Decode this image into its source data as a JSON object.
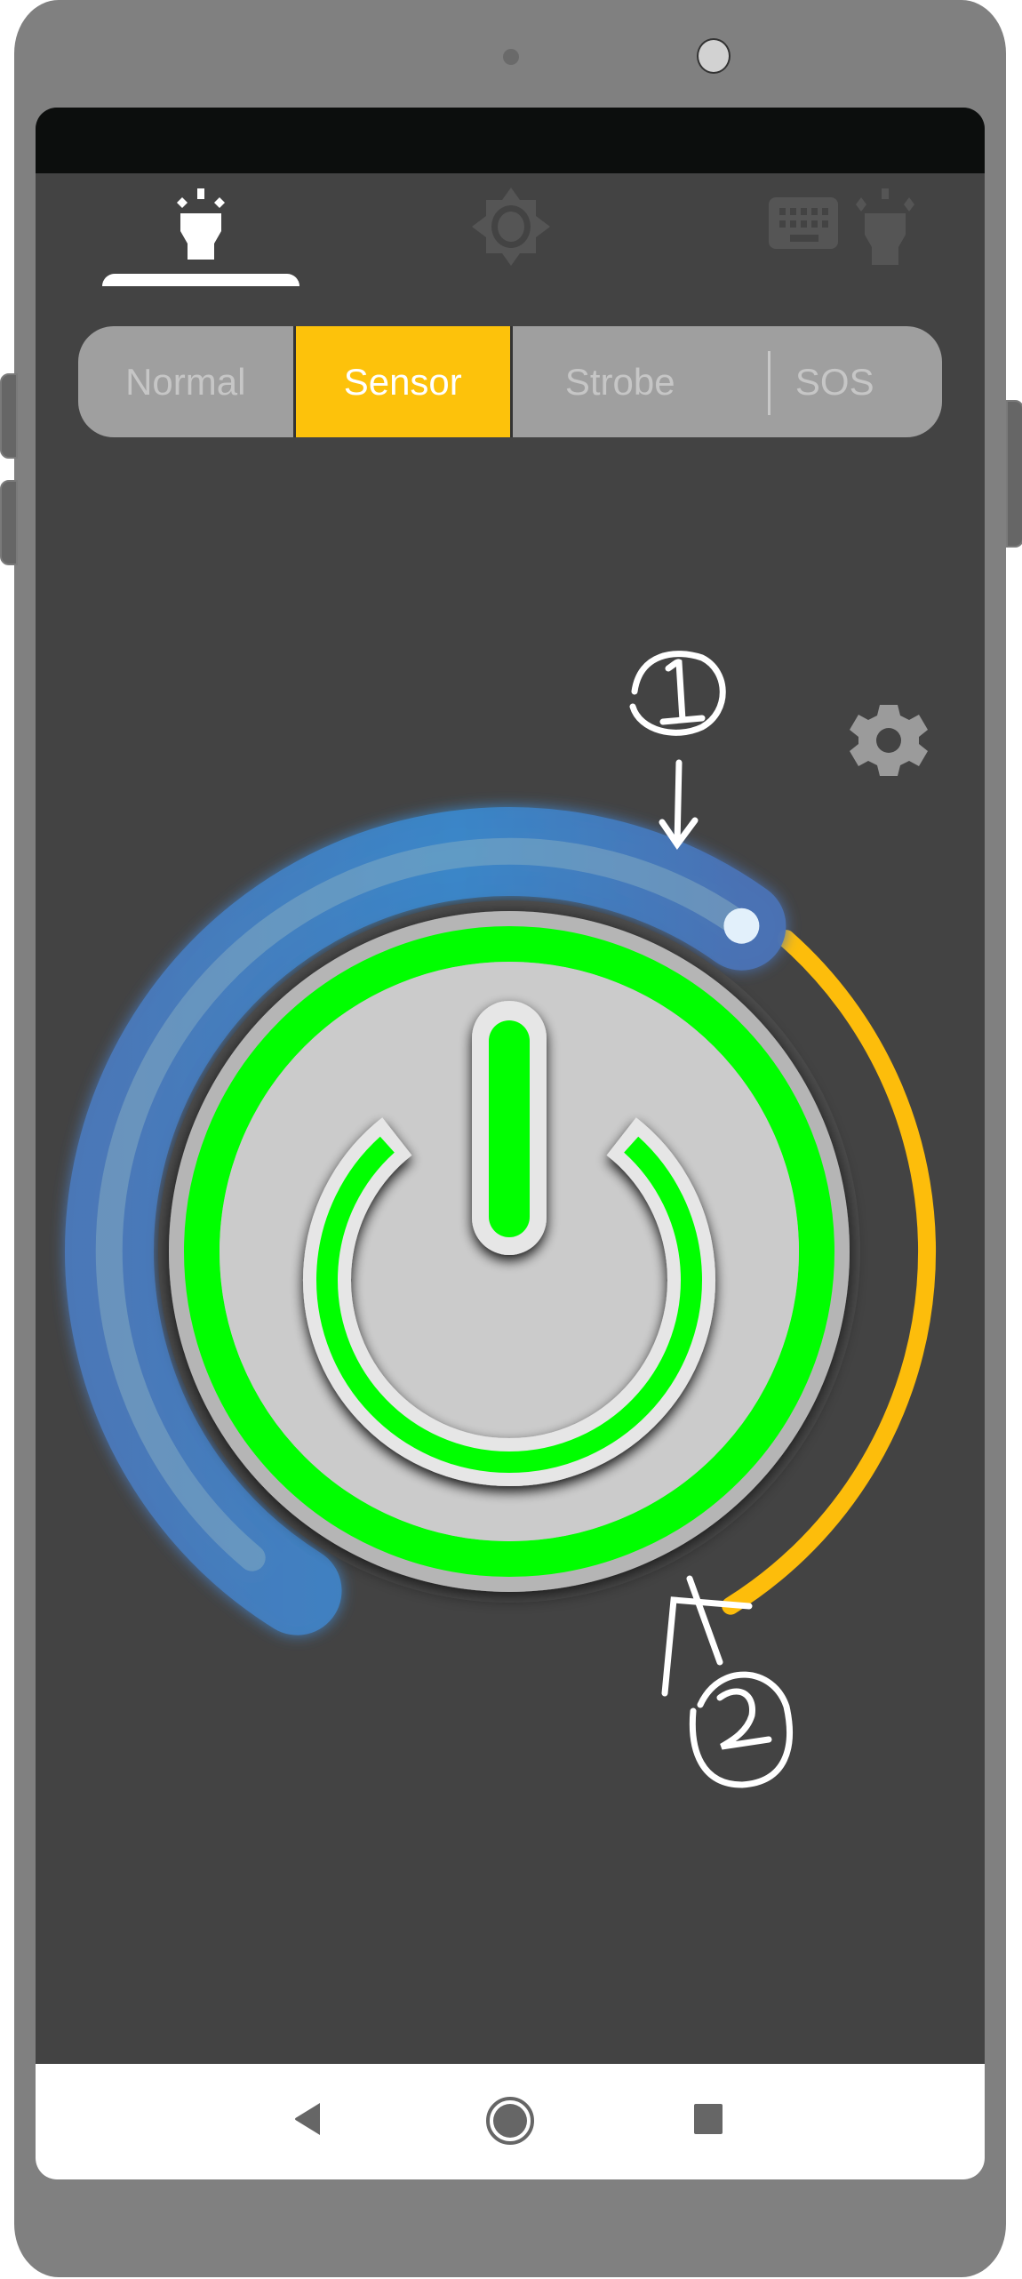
{
  "device": {
    "frame_color": "#808080",
    "screen_bg": "#434343",
    "statusbar_color": "#0c0e0d"
  },
  "top_tabs": [
    {
      "id": "flashlight",
      "icon": "flashlight-icon",
      "active": true
    },
    {
      "id": "screen-light",
      "icon": "brightness-icon",
      "active": false
    },
    {
      "id": "keyboard-flashlight",
      "icon": "keyboard-flashlight-icon",
      "active": false
    }
  ],
  "modes": {
    "items": [
      {
        "label": "Normal",
        "active": false
      },
      {
        "label": "Sensor",
        "active": true
      },
      {
        "label": "Strobe",
        "active": false
      },
      {
        "label": "SOS",
        "active": false
      }
    ],
    "active_color": "#fdc20b",
    "inactive_bg": "#9f9f9f"
  },
  "sensor_control": {
    "settings_icon": "gear-icon",
    "threshold_slider": {
      "color": "#3a7fc6",
      "value_fraction": 0.62
    },
    "range_arc_color": "#fdbd0b",
    "power_button": {
      "state": "on",
      "ring_color": "#00ff00",
      "icon": "power-icon"
    }
  },
  "annotations": [
    {
      "label": "1",
      "target": "threshold-slider-handle"
    },
    {
      "label": "2",
      "target": "power-button"
    }
  ],
  "navbar": {
    "back": "back-icon",
    "home": "home-icon",
    "recents": "recents-icon"
  }
}
